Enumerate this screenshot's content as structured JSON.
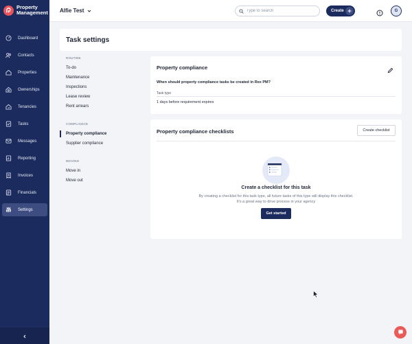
{
  "brand": {
    "name_line1": "Property",
    "name_line2": "Management",
    "logo_icon": "rex-logo-icon"
  },
  "header": {
    "account_name": "Alfie Test",
    "search_placeholder": "Type to search",
    "create_label": "Create",
    "avatar_initial": "G"
  },
  "sidebar": {
    "items": [
      {
        "label": "Dashboard",
        "icon": "dashboard-icon"
      },
      {
        "label": "Contacts",
        "icon": "contacts-icon"
      },
      {
        "label": "Properties",
        "icon": "house-icon"
      },
      {
        "label": "Ownerships",
        "icon": "ownership-icon"
      },
      {
        "label": "Tenancies",
        "icon": "key-icon"
      },
      {
        "label": "Tasks",
        "icon": "tasks-icon"
      },
      {
        "label": "Messages",
        "icon": "envelope-icon"
      },
      {
        "label": "Reporting",
        "icon": "report-icon"
      },
      {
        "label": "Invoices",
        "icon": "invoice-icon"
      },
      {
        "label": "Financials",
        "icon": "financials-icon"
      },
      {
        "label": "Settings",
        "icon": "sliders-icon"
      }
    ],
    "active": "Settings"
  },
  "page": {
    "title": "Task settings"
  },
  "subnav": {
    "groups": [
      {
        "title": "ROUTINE",
        "items": [
          "To-do",
          "Maintenance",
          "Inspections",
          "Lease review",
          "Rent arrears"
        ]
      },
      {
        "title": "COMPLIANCE",
        "items": [
          "Property compliance",
          "Supplier compliance"
        ]
      },
      {
        "title": "MOVING",
        "items": [
          "Move in",
          "Move out"
        ]
      }
    ],
    "active": "Property compliance"
  },
  "compliance_panel": {
    "title": "Property compliance",
    "question": "When should property compliance tasks be created in Rex PM?",
    "field_label": "Task type",
    "field_value": "1 days before requirement expires"
  },
  "checklists_panel": {
    "title": "Property compliance checklists",
    "create_button": "Create checklist",
    "empty_title": "Create a checklist for this task",
    "empty_description": "By creating a checklist for this task type, all future tasks of this type will display this checklist. It's a great way to drive process in your agency",
    "get_started_button": "Get started"
  },
  "colors": {
    "sidebar": "#1b2b5e",
    "accent": "#1b2b5e",
    "fab": "#ea5a57"
  }
}
